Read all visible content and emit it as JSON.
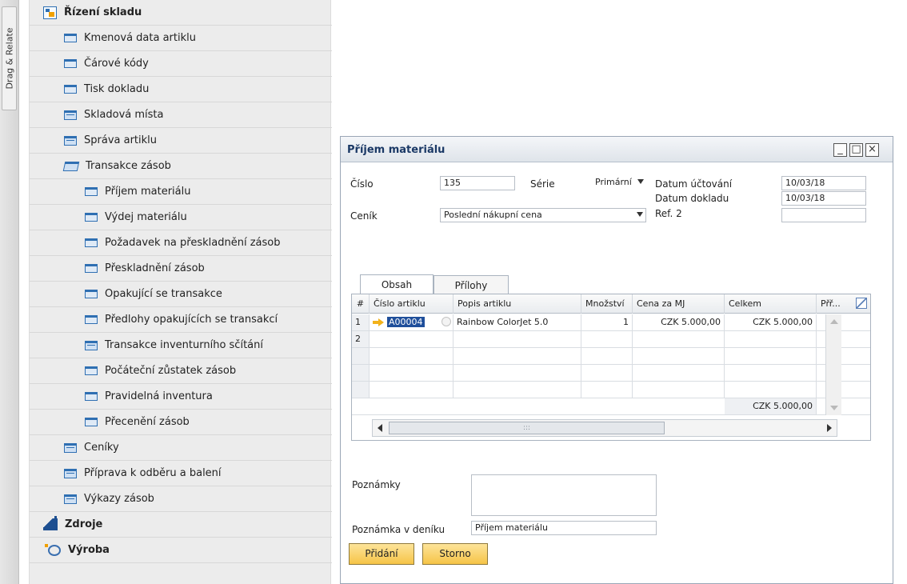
{
  "sidebar": {
    "tab_label": "Drag & Relate",
    "items": [
      {
        "label": "Řízení skladu"
      },
      {
        "label": "Kmenová data artiklu"
      },
      {
        "label": "Čárové kódy"
      },
      {
        "label": "Tisk dokladu"
      },
      {
        "label": "Skladová místa"
      },
      {
        "label": "Správa artiklu"
      },
      {
        "label": "Transakce zásob"
      },
      {
        "label": "Příjem materiálu"
      },
      {
        "label": "Výdej materiálu"
      },
      {
        "label": "Požadavek na přeskladnění zásob"
      },
      {
        "label": "Přeskladnění zásob"
      },
      {
        "label": "Opakující se transakce"
      },
      {
        "label": "Předlohy opakujících se transakcí"
      },
      {
        "label": "Transakce inventurního sčítání"
      },
      {
        "label": "Počáteční zůstatek zásob"
      },
      {
        "label": "Pravidelná inventura"
      },
      {
        "label": "Přecenění zásob"
      },
      {
        "label": "Ceníky"
      },
      {
        "label": "Příprava k odběru a balení"
      },
      {
        "label": "Výkazy zásob"
      },
      {
        "label": "Zdroje"
      },
      {
        "label": "Výroba"
      }
    ]
  },
  "dialog": {
    "title": "Příjem materiálu",
    "window_buttons": {
      "minimize": "_",
      "maximize": "□",
      "close": "×"
    },
    "fields": {
      "cislo_label": "Číslo",
      "cislo_value": "135",
      "serie_label": "Série",
      "serie_value": "Primární",
      "datum_uctovani_label": "Datum účtování",
      "datum_uctovani_value": "10/03/18",
      "datum_dokladu_label": "Datum dokladu",
      "datum_dokladu_value": "10/03/18",
      "cenik_label": "Ceník",
      "cenik_value": "Poslední nákupní cena",
      "ref2_label": "Ref. 2",
      "ref2_value": ""
    },
    "tabs": [
      {
        "label": "Obsah"
      },
      {
        "label": "Přílohy"
      }
    ],
    "grid": {
      "columns": [
        "#",
        "Číslo artiklu",
        "Popis artiklu",
        "Množství",
        "Cena za MJ",
        "Celkem",
        "Přř..."
      ],
      "rows": [
        {
          "num": "1",
          "code": "A00004",
          "description": "Rainbow ColorJet 5.0",
          "quantity": "1",
          "unit_price": "CZK 5.000,00",
          "total": "CZK 5.000,00"
        },
        {
          "num": "2",
          "code": "",
          "description": "",
          "quantity": "",
          "unit_price": "",
          "total": ""
        }
      ],
      "footer_total": "CZK 5.000,00",
      "scroll_thumb_text": ":::"
    },
    "notes_label": "Poznámky",
    "notes_value": "",
    "journal_note_label": "Poznámka v deníku",
    "journal_note_value": "Příjem materiálu",
    "buttons": {
      "add": "Přidání",
      "cancel": "Storno"
    }
  }
}
